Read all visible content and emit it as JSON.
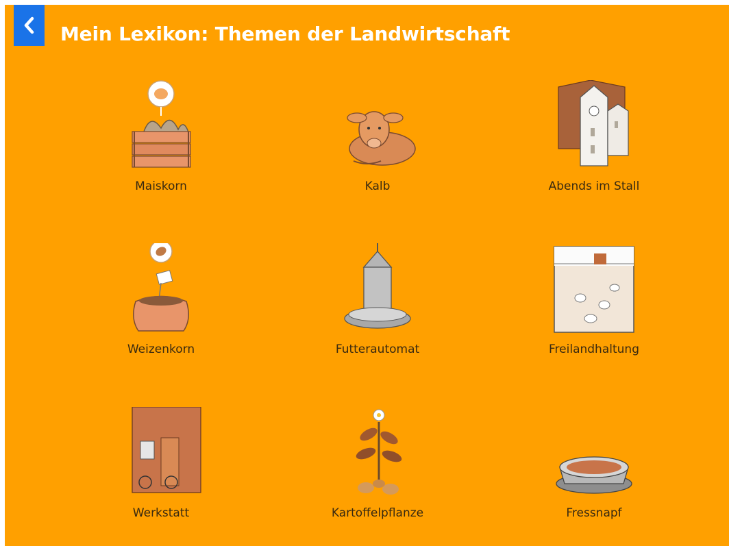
{
  "header": {
    "title": "Mein Lexikon: Themen der Landwirtschaft",
    "back_icon": "chevron-left-icon"
  },
  "colors": {
    "background": "#ffa000",
    "back_button": "#1a73e8",
    "title_text": "#ffffff",
    "label_text": "#3a2a10"
  },
  "topics": [
    {
      "label": "Maiskorn",
      "icon": "corn-crate-icon"
    },
    {
      "label": "Kalb",
      "icon": "calf-icon"
    },
    {
      "label": "Abends im Stall",
      "icon": "barn-evening-icon"
    },
    {
      "label": "Weizenkorn",
      "icon": "wheat-sack-icon"
    },
    {
      "label": "Futterautomat",
      "icon": "feeder-icon"
    },
    {
      "label": "Freilandhaltung",
      "icon": "free-range-chickens-icon"
    },
    {
      "label": "Werkstatt",
      "icon": "workshop-icon"
    },
    {
      "label": "Kartoffelpflanze",
      "icon": "potato-plant-icon"
    },
    {
      "label": "Fressnapf",
      "icon": "food-bowl-icon"
    }
  ]
}
